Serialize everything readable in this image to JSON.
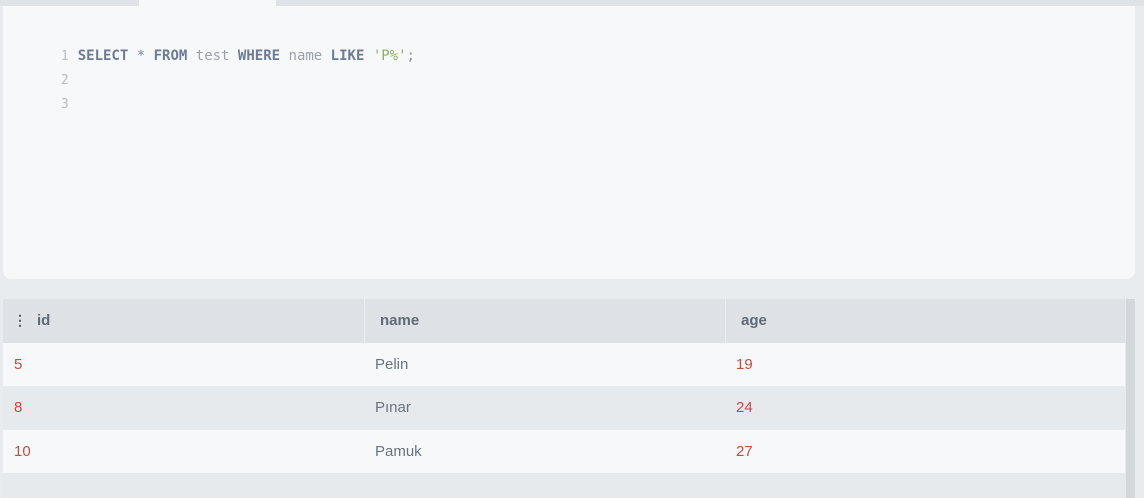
{
  "editor": {
    "line_numbers": [
      "1",
      "2",
      "3"
    ],
    "query": {
      "select": "SELECT",
      "star": "*",
      "from": "FROM",
      "table": "test",
      "where": "WHERE",
      "column": "name",
      "like": "LIKE",
      "pattern": "'P%'",
      "terminator": ";"
    }
  },
  "results": {
    "columns": [
      "id",
      "name",
      "age"
    ],
    "rows": [
      [
        "5",
        "Pelin",
        "19"
      ],
      [
        "8",
        "Pınar",
        "24"
      ],
      [
        "10",
        "Pamuk",
        "27"
      ]
    ]
  },
  "colors": {
    "number": "#c64b3f",
    "string": "#89b25f",
    "keyword": "#6c7b96"
  },
  "icons": {
    "header_grip": "vertical-ellipsis-icon"
  }
}
